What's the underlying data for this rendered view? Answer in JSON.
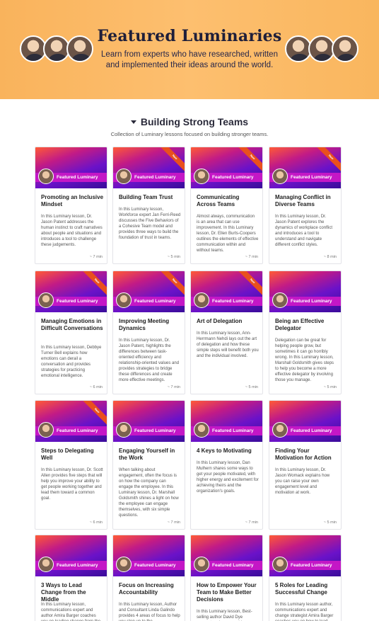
{
  "hero": {
    "title": "Featured Luminaries",
    "subtitle": "Learn from experts who have researched, written and implemented their ideas around the world.",
    "background": "#fdbb69"
  },
  "section": {
    "title": "Building Strong Teams",
    "description": "Collection of Luminary lessons focused on building stronger teams."
  },
  "card_badge": "New",
  "card_label": "Featured Luminary",
  "colors": {
    "accent": "#c417c6",
    "badge": "#e9501e"
  },
  "cards": [
    {
      "title": "Promoting an Inclusive Mindset",
      "desc": "In this Luminary lesson, Dr. Jason Patent addresses the human instinct to craft narratives about people and situations and introduces a tool to challenge these judgements.",
      "time": "~ 7 min",
      "badge": false
    },
    {
      "title": "Building Team Trust",
      "desc": "In this Luminary lesson, Workforce expert Jan Ferri-Reed discusses the Five Behaviors of a Cohesive Team model and provides three ways to build the foundation of trust in teams.",
      "time": "~ 5 min",
      "badge": true
    },
    {
      "title": "Communicating Across Teams",
      "desc": "Almost always, communication is an area that can use improvement. In this Luminary lesson, Dr. Ellen Burts-Coopers outlines the elements of effective communication within and without teams.",
      "time": "~ 7 min",
      "badge": true
    },
    {
      "title": "Managing Conflict in Diverse Teams",
      "desc": "In this Luminary lesson, Dr. Jason Patent explores the dynamics of workplace conflict and introduces a tool to understand and navigate different conflict styles.",
      "time": "~ 8 min",
      "badge": true
    },
    {
      "title": "Managing Emotions in Difficult Conversations",
      "desc": "In this Luminary lesson, Debbye Turner Bell explains how emotions can derail a conversation and provides strategies for practicing emotional intelligence.",
      "time": "~ 6 min",
      "badge": true
    },
    {
      "title": "Improving Meeting Dynamics",
      "desc": "In this Luminary lesson, Dr. Jason Patent, highlights the differences between task-oriented efficiency and relationship-oriented values and provides strategies to bridge these differences and create more effective meetings.",
      "time": "~ 7 min",
      "badge": true
    },
    {
      "title": "Art of Delegation",
      "desc": "In this Luminary lesson, Ann-Herrmann Nehdi lays out the art of delegation and how these simple steps will benefit both you and the individual involved.",
      "time": "~ 5 min",
      "badge": true
    },
    {
      "title": "Being an Effective Delegator",
      "desc": "Delegation can be great for helping people grow, but sometimes it can go horribly wrong. In this Luminary lesson, Marshall Goldsmith gives steps to help you become a more effective delegator by involving those you manage.",
      "time": "~ 5 min",
      "badge": false
    },
    {
      "title": "Steps to Delegating Well",
      "desc": "In this Luminary lesson, Dr. Scott Allen provides five steps that will help you improve your ability to get people working together and lead them toward a common goal.",
      "time": "~ 6 min",
      "badge": true
    },
    {
      "title": "Engaging Yourself in the Work",
      "desc": "When talking about engagement, often the focus is on how the company can engage the employee. In this Luminary lesson, Dr. Marshall Goldsmith shines a light on how the employee can engage themselves, with six simple questions.",
      "time": "~ 7 min",
      "badge": false
    },
    {
      "title": "4 Keys to Motivating",
      "desc": "In this Luminary lesson, Dan Mulhern shares some ways to get your people motivated, with higher energy and excitement for achieving theirs and the organization's goals.",
      "time": "~ 7 min",
      "badge": false
    },
    {
      "title": "Finding Your Motivation for Action",
      "desc": "In this Luminary lesson, Dr. Jason Womack explains how you can raise your own engagement level and motivation at work.",
      "time": "~ 5 min",
      "badge": false
    },
    {
      "title": "3 Ways to Lead Change from the Middle",
      "desc": "In this Luminary lesson, communications expert and author Amira Barger coaches you on leading change from the",
      "time": "",
      "badge": false
    },
    {
      "title": "Focus on Increasing Accountability",
      "desc": "In this Luminary lesson, Author and Consultant Linda Galindo provides 4 areas of focus to help you step up to the",
      "time": "",
      "badge": false
    },
    {
      "title": "How to Empower Your Team to Make Better Decisions",
      "desc": "In this Luminary lesson, Best-selling author David Dye suggests using a coaching",
      "time": "",
      "badge": false
    },
    {
      "title": "5 Roles for Leading Successful Change",
      "desc": "In this Luminary lesson author, communications expert and change strategist Amira Barger coaches you on how to lead",
      "time": "",
      "badge": false
    }
  ]
}
